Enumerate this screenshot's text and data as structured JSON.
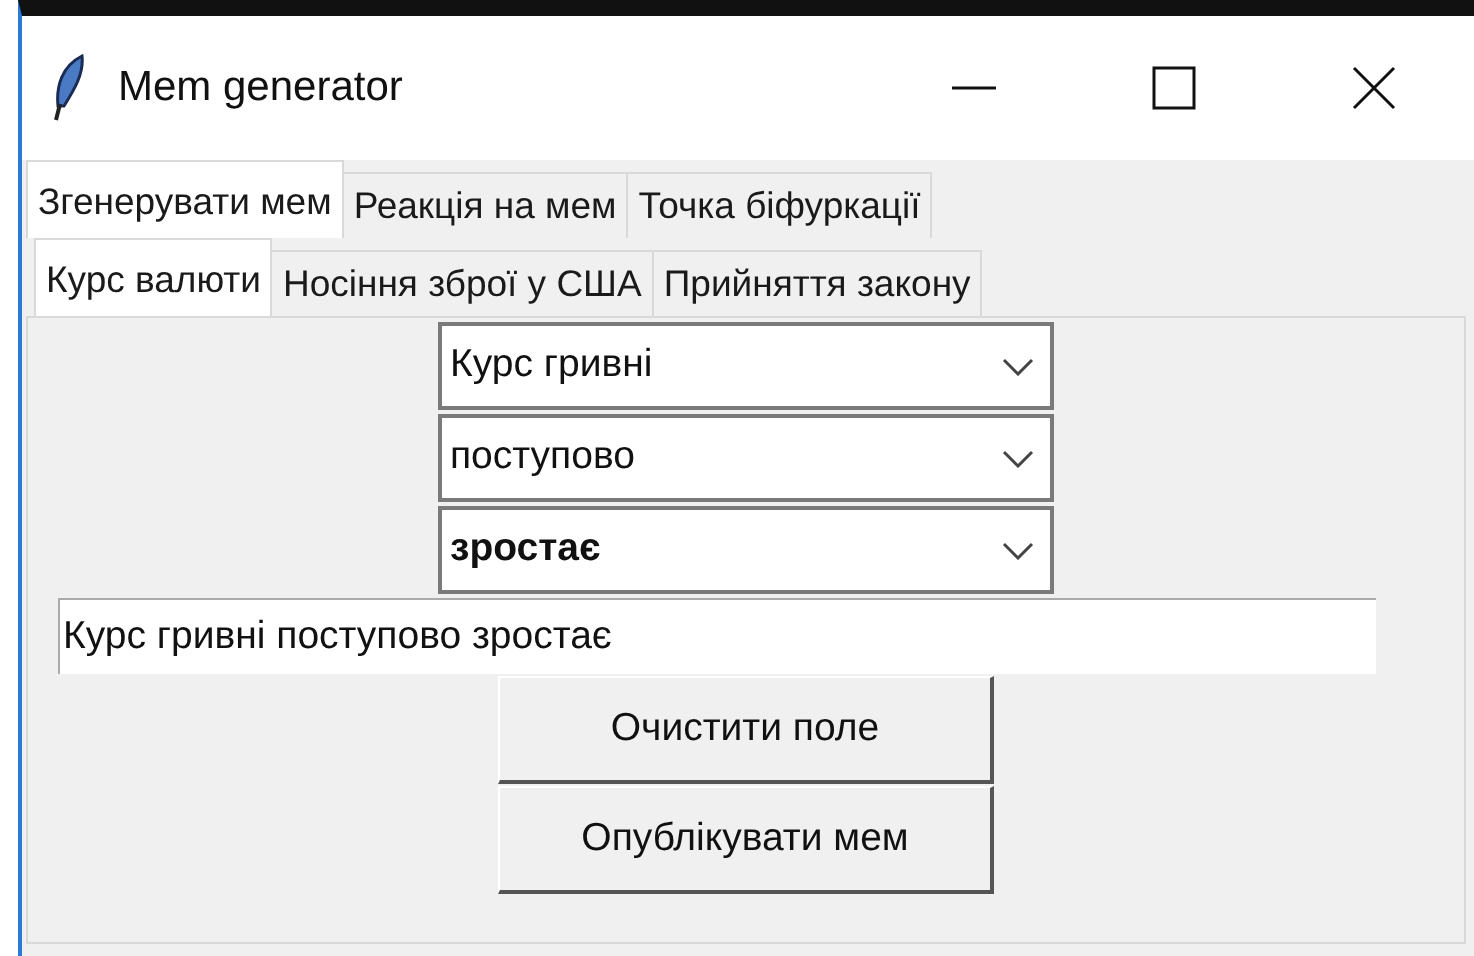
{
  "window": {
    "title": "Mem generator"
  },
  "tabs": [
    {
      "label": "Згенерувати мем",
      "selected": true
    },
    {
      "label": "Реакція на мем",
      "selected": false
    },
    {
      "label": "Точка біфуркації",
      "selected": false
    }
  ],
  "subtabs": [
    {
      "label": "Курс валюти",
      "selected": true
    },
    {
      "label": "Носіння зброї у США",
      "selected": false
    },
    {
      "label": "Прийняття закону",
      "selected": false
    }
  ],
  "comboboxes": [
    {
      "value": "Курс гривні",
      "bold": false
    },
    {
      "value": "поступово",
      "bold": false
    },
    {
      "value": "зростає",
      "bold": true
    }
  ],
  "entry": {
    "value": "Курс гривні поступово зростає"
  },
  "buttons": [
    "Очистити поле",
    "Опублікувати мем"
  ]
}
